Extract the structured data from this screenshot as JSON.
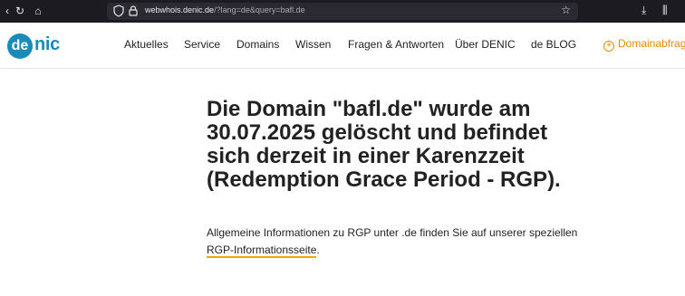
{
  "browser": {
    "url_host": "webwhois.denic.de",
    "url_path": "/?lang=de&query=bafl.de"
  },
  "logo": {
    "circle_text": "de",
    "rest_text": "nic"
  },
  "nav": {
    "items": [
      "Aktuelles",
      "Service",
      "Domains",
      "Wissen",
      "Fragen & Antworten",
      "Über DENIC",
      "de BLOG"
    ],
    "domainabfrage": "Domainabfrage"
  },
  "main": {
    "headline": "Die Domain \"bafl.de\" wurde am 30.07.2025 gelöscht und befindet sich derzeit in einer Karenzzeit (Redemption Grace Period - RGP).",
    "info_text": "Allgemeine Informationen zu RGP unter .de finden Sie auf unserer speziellen ",
    "info_link": "RGP-Informationsseite",
    "info_end": "."
  },
  "colors": {
    "brand_blue": "#1b8ab8",
    "accent_orange": "#e58e00",
    "browser_dark": "#1c1b22"
  }
}
